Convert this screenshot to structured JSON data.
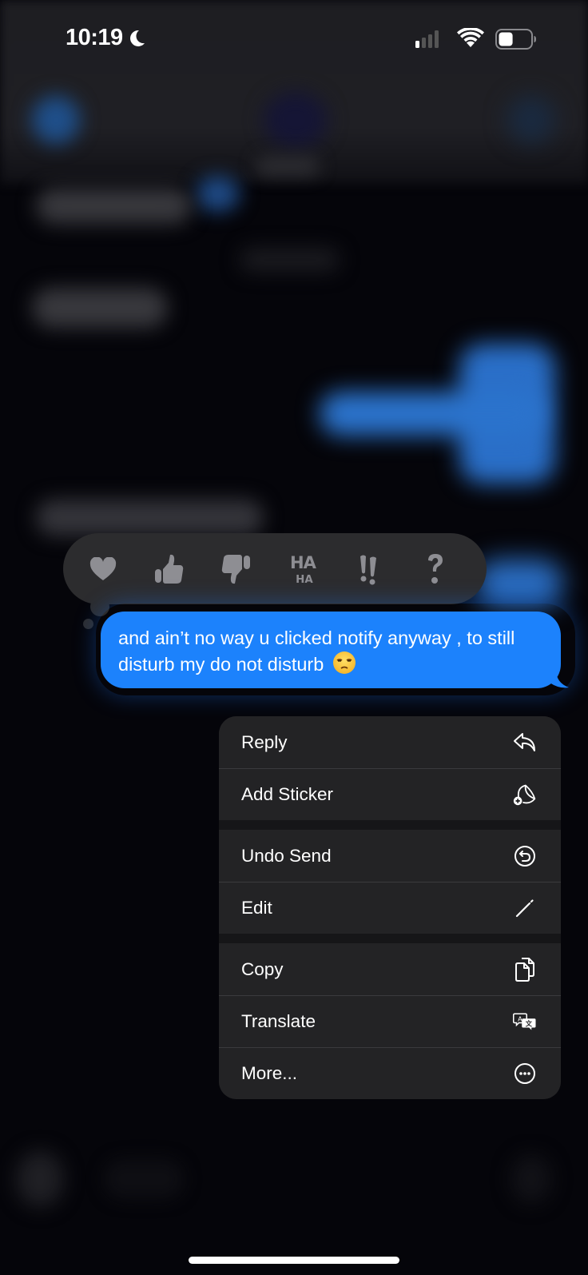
{
  "status_bar": {
    "time": "10:19",
    "focus_icon": "moon-icon",
    "signal_bars_active": 1,
    "signal_bars_total": 4,
    "wifi_icon": "wifi-icon",
    "battery_level_fraction": 0.45
  },
  "tapbacks": [
    {
      "name": "heart",
      "icon": "heart-icon"
    },
    {
      "name": "thumbs-up",
      "icon": "thumbs-up-icon"
    },
    {
      "name": "thumbs-down",
      "icon": "thumbs-down-icon"
    },
    {
      "name": "haha",
      "icon": "haha-icon",
      "label_top": "HA",
      "label_bottom": "HA"
    },
    {
      "name": "emphasize",
      "icon": "double-exclamation-icon",
      "label": "!!"
    },
    {
      "name": "question",
      "icon": "question-mark-icon",
      "label": "?"
    }
  ],
  "message": {
    "text": "and ain’t no way u clicked notify anyway , to still disturb my do not disturb",
    "emoji": "unamused-face-emoji",
    "bubble_color": "#1c82fc"
  },
  "menu": {
    "groups": [
      [
        {
          "label": "Reply",
          "icon": "reply-arrow-icon"
        },
        {
          "label": "Add Sticker",
          "icon": "add-sticker-icon"
        }
      ],
      [
        {
          "label": "Undo Send",
          "icon": "undo-send-icon"
        },
        {
          "label": "Edit",
          "icon": "pencil-icon"
        }
      ],
      [
        {
          "label": "Copy",
          "icon": "copy-icon"
        },
        {
          "label": "Translate",
          "icon": "translate-icon"
        },
        {
          "label": "More...",
          "icon": "more-ellipsis-icon"
        }
      ]
    ]
  },
  "colors": {
    "accent_blue": "#1c82fc",
    "menu_background": "#232325",
    "tapback_background": "#2c2c2e",
    "tapback_icon": "#8e8e93"
  }
}
